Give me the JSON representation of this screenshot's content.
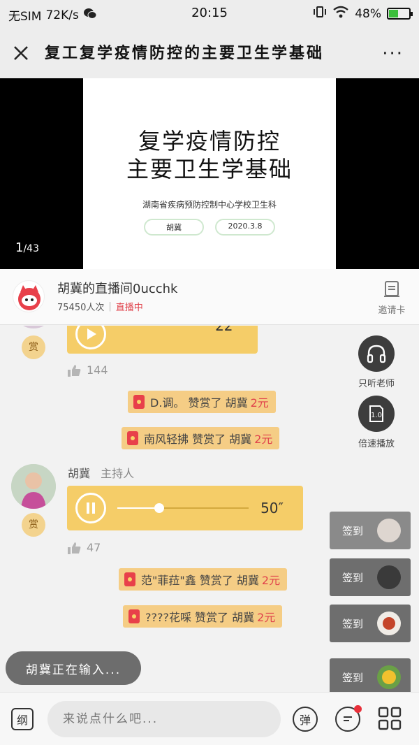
{
  "status_bar": {
    "carrier": "无SIM",
    "speed": "72K/s",
    "time": "20:15",
    "battery": "48%",
    "battery_level": 0.48
  },
  "header": {
    "title": "复工复学疫情防控的主要卫生学基础",
    "more_label": "···"
  },
  "slide": {
    "title_line1": "复学疫情防控",
    "title_line2": "主要卫生学基础",
    "org": "湖南省疾病预防控制中心学校卫生科",
    "author": "胡冀",
    "date": "2020.3.8",
    "page_current": "1",
    "page_total": "/43"
  },
  "host": {
    "name": "胡冀的直播间0ucchk",
    "views": "75450人次",
    "separator": "|",
    "status": "直播中",
    "invite_label": "邀请卡"
  },
  "chat": {
    "reward_label": "赏",
    "msg1": {
      "duration": "22″",
      "likes": "144"
    },
    "tip1": {
      "text": "D.调。 赞赏了 胡冀",
      "amount": "2元"
    },
    "tip2": {
      "text": "南风轻拂 赞赏了 胡冀",
      "amount": "2元"
    },
    "msg2": {
      "sender": "胡冀",
      "role": "主持人",
      "duration": "50″",
      "likes": "47",
      "progress": 0.32
    },
    "tip3": {
      "text": "范\"菲菈\"鑫 赞赏了 胡冀",
      "amount": "2元"
    },
    "tip4": {
      "text": "????花啋 赞赏了 胡冀",
      "amount": "2元"
    }
  },
  "side_buttons": {
    "listen_teacher": "只听老师",
    "speed_play": "倍速播放",
    "speed_value": "1.0"
  },
  "signins": [
    "签到",
    "签到",
    "签到",
    "签到"
  ],
  "typing_indicator": "胡冀正在输入...",
  "bottom_bar": {
    "outline_label": "纲",
    "input_placeholder": "来说点什么吧...",
    "danmu_label": "弹"
  }
}
